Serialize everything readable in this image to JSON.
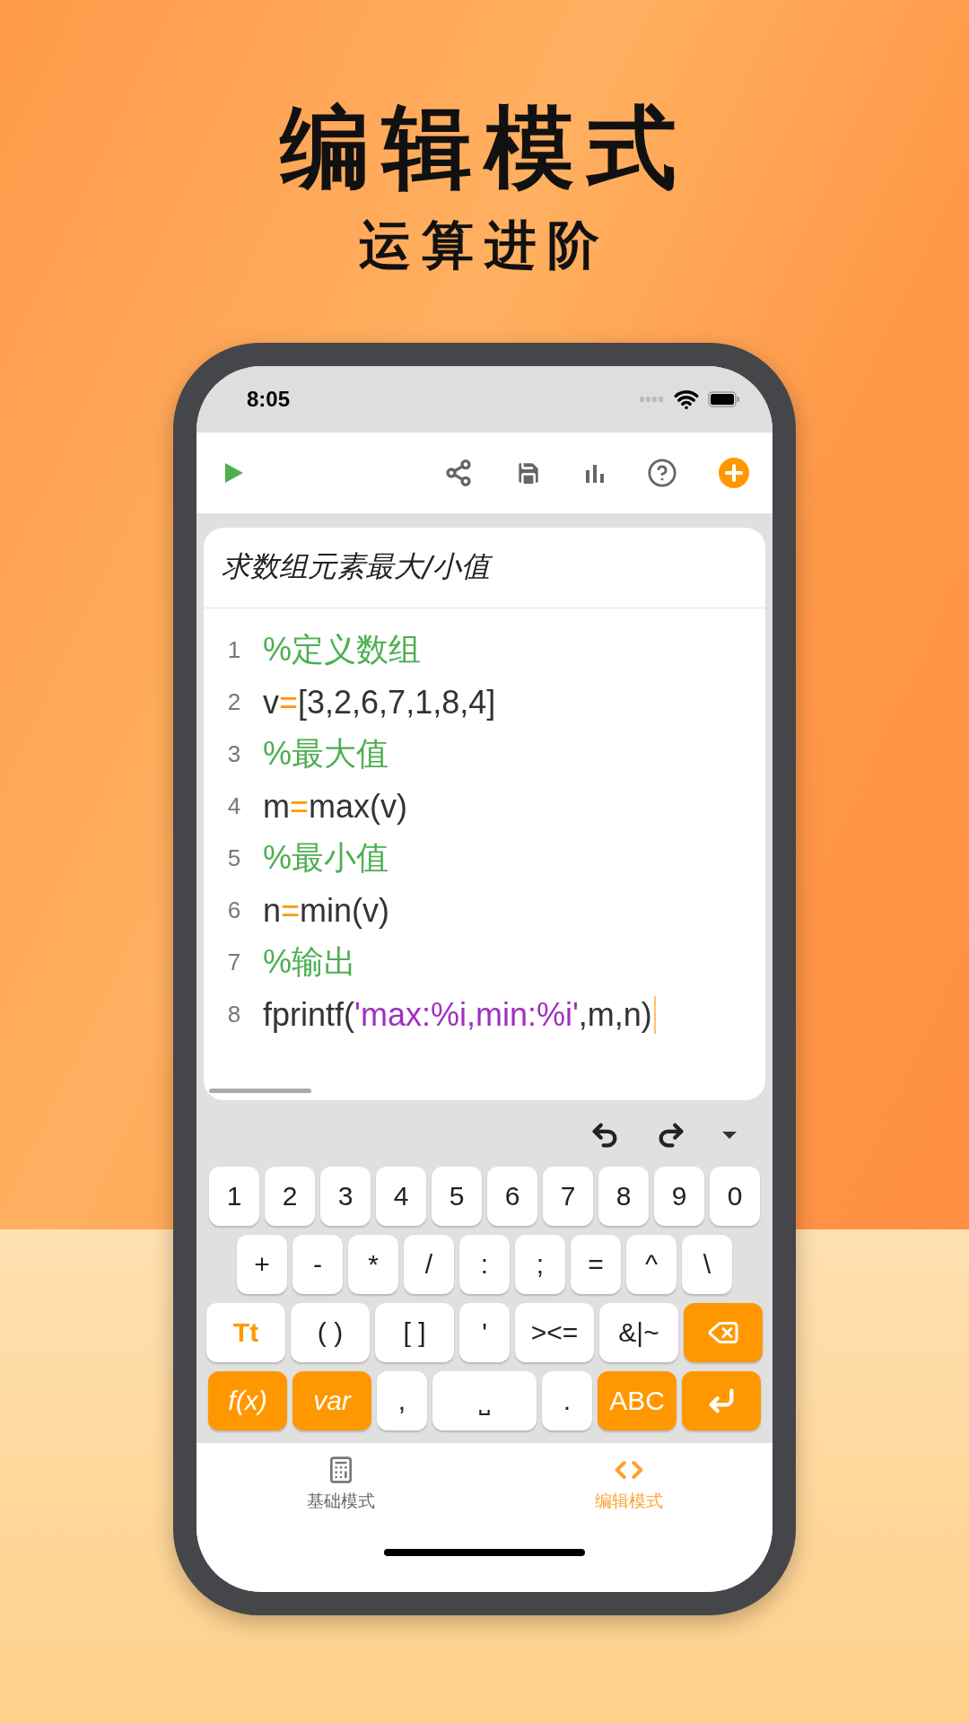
{
  "headline": "编辑模式",
  "subheadline": "运算进阶",
  "status_bar": {
    "time": "8:05"
  },
  "editor": {
    "title": "求数组元素最大/小值",
    "lines": [
      {
        "number": "1",
        "cursor": false,
        "segments": [
          {
            "kind": "comment",
            "text": "%定义数组"
          }
        ]
      },
      {
        "number": "2",
        "cursor": false,
        "segments": [
          {
            "kind": "plain",
            "text": "v"
          },
          {
            "kind": "operator",
            "text": "="
          },
          {
            "kind": "plain",
            "text": "[3,2,6,7,1,8,4]"
          }
        ]
      },
      {
        "number": "3",
        "cursor": false,
        "segments": [
          {
            "kind": "comment",
            "text": "%最大值"
          }
        ]
      },
      {
        "number": "4",
        "cursor": false,
        "segments": [
          {
            "kind": "plain",
            "text": "m"
          },
          {
            "kind": "operator",
            "text": "="
          },
          {
            "kind": "plain",
            "text": "max(v)"
          }
        ]
      },
      {
        "number": "5",
        "cursor": false,
        "segments": [
          {
            "kind": "comment",
            "text": "%最小值"
          }
        ]
      },
      {
        "number": "6",
        "cursor": false,
        "segments": [
          {
            "kind": "plain",
            "text": "n"
          },
          {
            "kind": "operator",
            "text": "="
          },
          {
            "kind": "plain",
            "text": "min(v)"
          }
        ]
      },
      {
        "number": "7",
        "cursor": false,
        "segments": [
          {
            "kind": "comment",
            "text": "%输出"
          }
        ]
      },
      {
        "number": "8",
        "cursor": true,
        "segments": [
          {
            "kind": "plain",
            "text": "fprintf("
          },
          {
            "kind": "string",
            "text": "'max:%i,min:%i'"
          },
          {
            "kind": "plain",
            "text": ",m,n)"
          }
        ]
      }
    ]
  },
  "keyboard": {
    "rows": [
      {
        "keys": [
          {
            "kind": "key",
            "text": "1"
          },
          {
            "kind": "key",
            "text": "2"
          },
          {
            "kind": "key",
            "text": "3"
          },
          {
            "kind": "key",
            "text": "4"
          },
          {
            "kind": "key",
            "text": "5"
          },
          {
            "kind": "key",
            "text": "6"
          },
          {
            "kind": "key",
            "text": "7"
          },
          {
            "kind": "key",
            "text": "8"
          },
          {
            "kind": "key",
            "text": "9"
          },
          {
            "kind": "key",
            "text": "0"
          }
        ]
      },
      {
        "keys": [
          {
            "kind": "key",
            "text": "+"
          },
          {
            "kind": "key",
            "text": "-"
          },
          {
            "kind": "key",
            "text": "*"
          },
          {
            "kind": "key",
            "text": "/"
          },
          {
            "kind": "key",
            "text": ":"
          },
          {
            "kind": "key",
            "text": ";"
          },
          {
            "kind": "key",
            "text": "="
          },
          {
            "kind": "key",
            "text": "^"
          },
          {
            "kind": "key",
            "text": "\\"
          }
        ]
      },
      {
        "keys": [
          {
            "kind": "case",
            "text": "Tt"
          },
          {
            "kind": "key",
            "text": "( )"
          },
          {
            "kind": "key",
            "text": "[ ]"
          },
          {
            "kind": "key",
            "text": "'"
          },
          {
            "kind": "key",
            "text": "><="
          },
          {
            "kind": "key",
            "text": "&|~"
          },
          {
            "kind": "backspace"
          }
        ]
      },
      {
        "keys": [
          {
            "kind": "fn",
            "text": "f(x)"
          },
          {
            "kind": "fn",
            "text": "var"
          },
          {
            "kind": "key",
            "text": ","
          },
          {
            "kind": "key",
            "text": "⎵"
          },
          {
            "kind": "key",
            "text": "."
          },
          {
            "kind": "mode",
            "text": "ABC"
          },
          {
            "kind": "enter"
          }
        ]
      }
    ]
  },
  "tabs": [
    {
      "label": "基础模式",
      "selected": false
    },
    {
      "label": "编辑模式",
      "selected": true
    }
  ]
}
